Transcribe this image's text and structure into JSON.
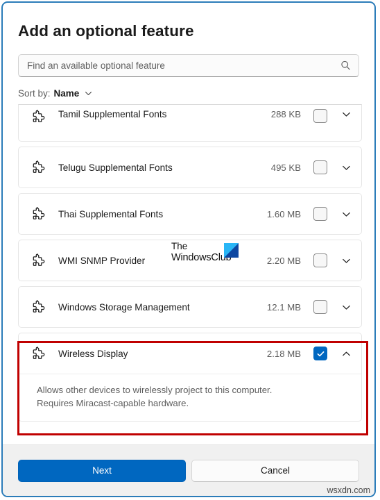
{
  "window": {
    "title": "Add an optional feature",
    "accent_color": "#0067c0",
    "border_color": "#2b7cb9",
    "highlight_color": "#c00000"
  },
  "search": {
    "placeholder": "Find an available optional feature",
    "value": "",
    "icon": "search-icon"
  },
  "sort": {
    "label": "Sort by:",
    "value": "Name",
    "chevron": "chevron-down-icon"
  },
  "features": [
    {
      "name": "Tamil Supplemental Fonts",
      "size": "288 KB",
      "checked": false,
      "expanded": false,
      "description": "",
      "partial": true
    },
    {
      "name": "Telugu Supplemental Fonts",
      "size": "495 KB",
      "checked": false,
      "expanded": false,
      "description": "",
      "partial": false
    },
    {
      "name": "Thai Supplemental Fonts",
      "size": "1.60 MB",
      "checked": false,
      "expanded": false,
      "description": "",
      "partial": false
    },
    {
      "name": "WMI SNMP Provider",
      "size": "2.20 MB",
      "checked": false,
      "expanded": false,
      "description": "",
      "partial": false
    },
    {
      "name": "Windows Storage Management",
      "size": "12.1 MB",
      "checked": false,
      "expanded": false,
      "description": "",
      "partial": false
    },
    {
      "name": "Wireless Display",
      "size": "2.18 MB",
      "checked": true,
      "expanded": true,
      "description": "Allows other devices to wirelessly project to this computer.\nRequires Miracast-capable hardware.",
      "partial": false
    }
  ],
  "footer": {
    "next_label": "Next",
    "cancel_label": "Cancel"
  },
  "watermarks": {
    "twc_line1": "The",
    "twc_line2": "WindowsClub",
    "site": "wsxdn.com"
  }
}
